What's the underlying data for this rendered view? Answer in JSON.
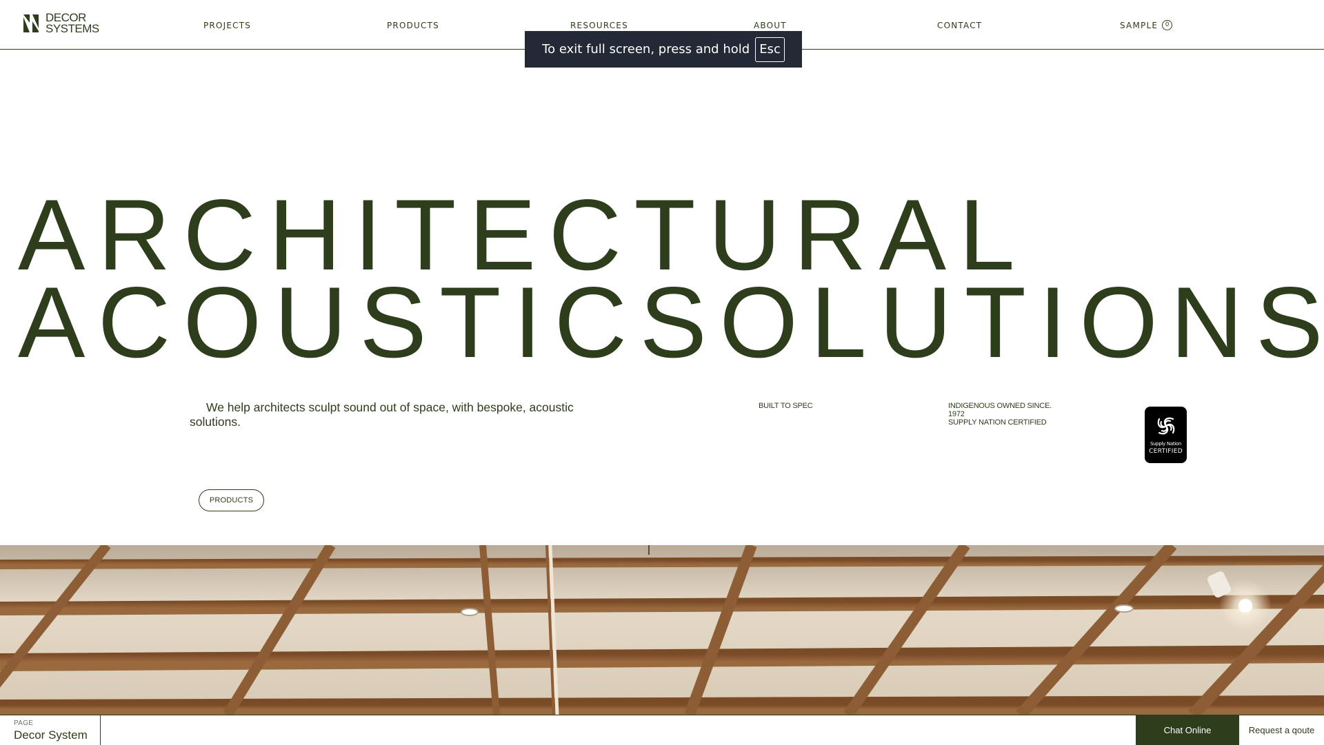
{
  "brand": {
    "line1": "DECOR",
    "line2": "SYSTEMS",
    "icon": "decor-systems-logo-icon"
  },
  "nav": {
    "projects": "PROJECTS",
    "products": "PRODUCTS",
    "resources": "RESOURCES",
    "about": "ABOUT",
    "contact": "CONTACT",
    "sample": "SAMPLE",
    "sample_count": "0"
  },
  "fullscreen_notice": {
    "text": "To exit full screen, press and hold",
    "key": "Esc"
  },
  "hero": {
    "line1": "ARCHITECTURAL",
    "line2": "ACOUSTICSOLUTIONS"
  },
  "tagline": "We help architects sculpt sound out of space, with bespoke, acoustic solutions.",
  "features": {
    "built_to_spec": "BUILT TO SPEC",
    "indigenous_line1": "INDIGENOUS OWNED SINCE.",
    "indigenous_line2": "1972",
    "indigenous_line3": "SUPPLY NATION CERTIFIED"
  },
  "badge": {
    "line1": "Supply Nation",
    "line2": "CERTIFIED"
  },
  "cta": {
    "products": "PRODUCTS"
  },
  "footer": {
    "page_label": "PAGE",
    "page_name": "Decor System",
    "chat": "Chat Online",
    "quote": "Request a qoute"
  },
  "colors": {
    "brand_green": "#2e3d1c",
    "toast_bg": "#242a35",
    "wood": "#8a5a32",
    "ceiling_panel": "#d9ccb8"
  }
}
